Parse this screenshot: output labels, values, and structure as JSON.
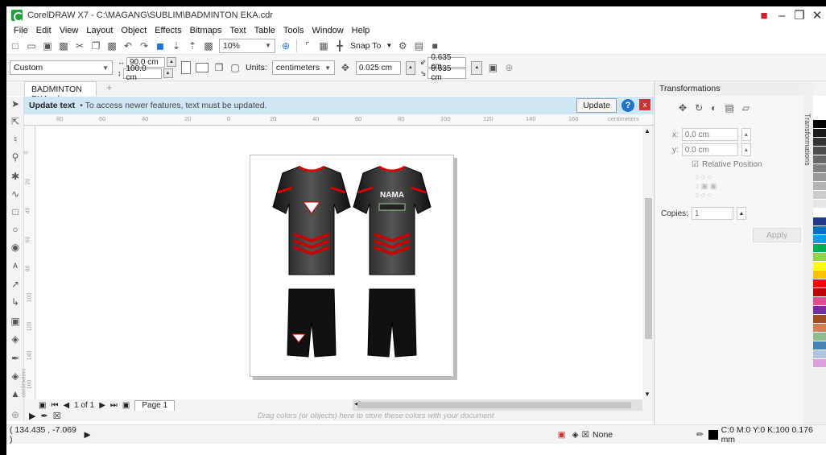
{
  "window": {
    "title": "CorelDRAW X7 - C:\\MAGANG\\SUBLIM\\BADMINTON EKA.cdr",
    "help_glyph": "■",
    "min": "–",
    "restore": "❐",
    "close": "✕"
  },
  "menu": [
    "File",
    "Edit",
    "View",
    "Layout",
    "Object",
    "Effects",
    "Bitmaps",
    "Text",
    "Table",
    "Tools",
    "Window",
    "Help"
  ],
  "toolbar": {
    "zoom": "10%",
    "snap": "Snap To"
  },
  "prop": {
    "preset": "Custom",
    "width": "90.0 cm",
    "height": "100.0 cm",
    "units_label": "Units:",
    "units": "centimeters",
    "nudge": "0.025 cm",
    "dup_x": "0.635 cm",
    "dup_y": "0.635 cm"
  },
  "tab": {
    "doc": "BADMINTON EKA.cdr",
    "add": "+"
  },
  "notice": {
    "title": "Update text",
    "sub": "•  To access newer features, text must be updated.",
    "button": "Update",
    "help": "?",
    "close": "x"
  },
  "ruler": {
    "ticks": [
      "80",
      "60",
      "40",
      "20",
      "0",
      "20",
      "40",
      "60",
      "80",
      "100",
      "120",
      "140",
      "160"
    ],
    "unit": "centimeters",
    "vticks": [
      "0",
      "20",
      "40",
      "60",
      "80",
      "100",
      "120",
      "140",
      "160"
    ],
    "vunit": "centimeters"
  },
  "jerseys": [
    {
      "label": "",
      "name": ""
    },
    {
      "label": "NAMA",
      "name": ""
    }
  ],
  "pagenav": {
    "count": "1 of 1",
    "page": "Page 1"
  },
  "palette_hint": "Drag colors (or objects) here to store these colors with your document",
  "status": {
    "coords": "( 134.435 , -7.069 )",
    "fill": "None",
    "outline": "C:0 M:0 Y:0 K:100  0.176 mm"
  },
  "docker": {
    "title": "Transformations",
    "tab": "Transformations",
    "x": "0.0 cm",
    "y": "0.0 cm",
    "x_label": "x:",
    "y_label": "y:",
    "relative": "Relative Position",
    "copies_label": "Copies:",
    "copies": "1",
    "apply": "Apply"
  },
  "colors": [
    "#ffffff",
    "#000000",
    "#1a1a1a",
    "#333333",
    "#4d4d4d",
    "#666666",
    "#808080",
    "#999999",
    "#b3b3b3",
    "#cccccc",
    "#e6e6e6",
    "#ffffff",
    "#1e3a8a",
    "#0070c0",
    "#00a0e0",
    "#00b050",
    "#92d050",
    "#ffff00",
    "#ffc000",
    "#ff0000",
    "#c00000",
    "#e05090",
    "#7030a0",
    "#a05020",
    "#d08050",
    "#8fbc8f",
    "#4682b4",
    "#b0c4de",
    "#dda0dd"
  ]
}
